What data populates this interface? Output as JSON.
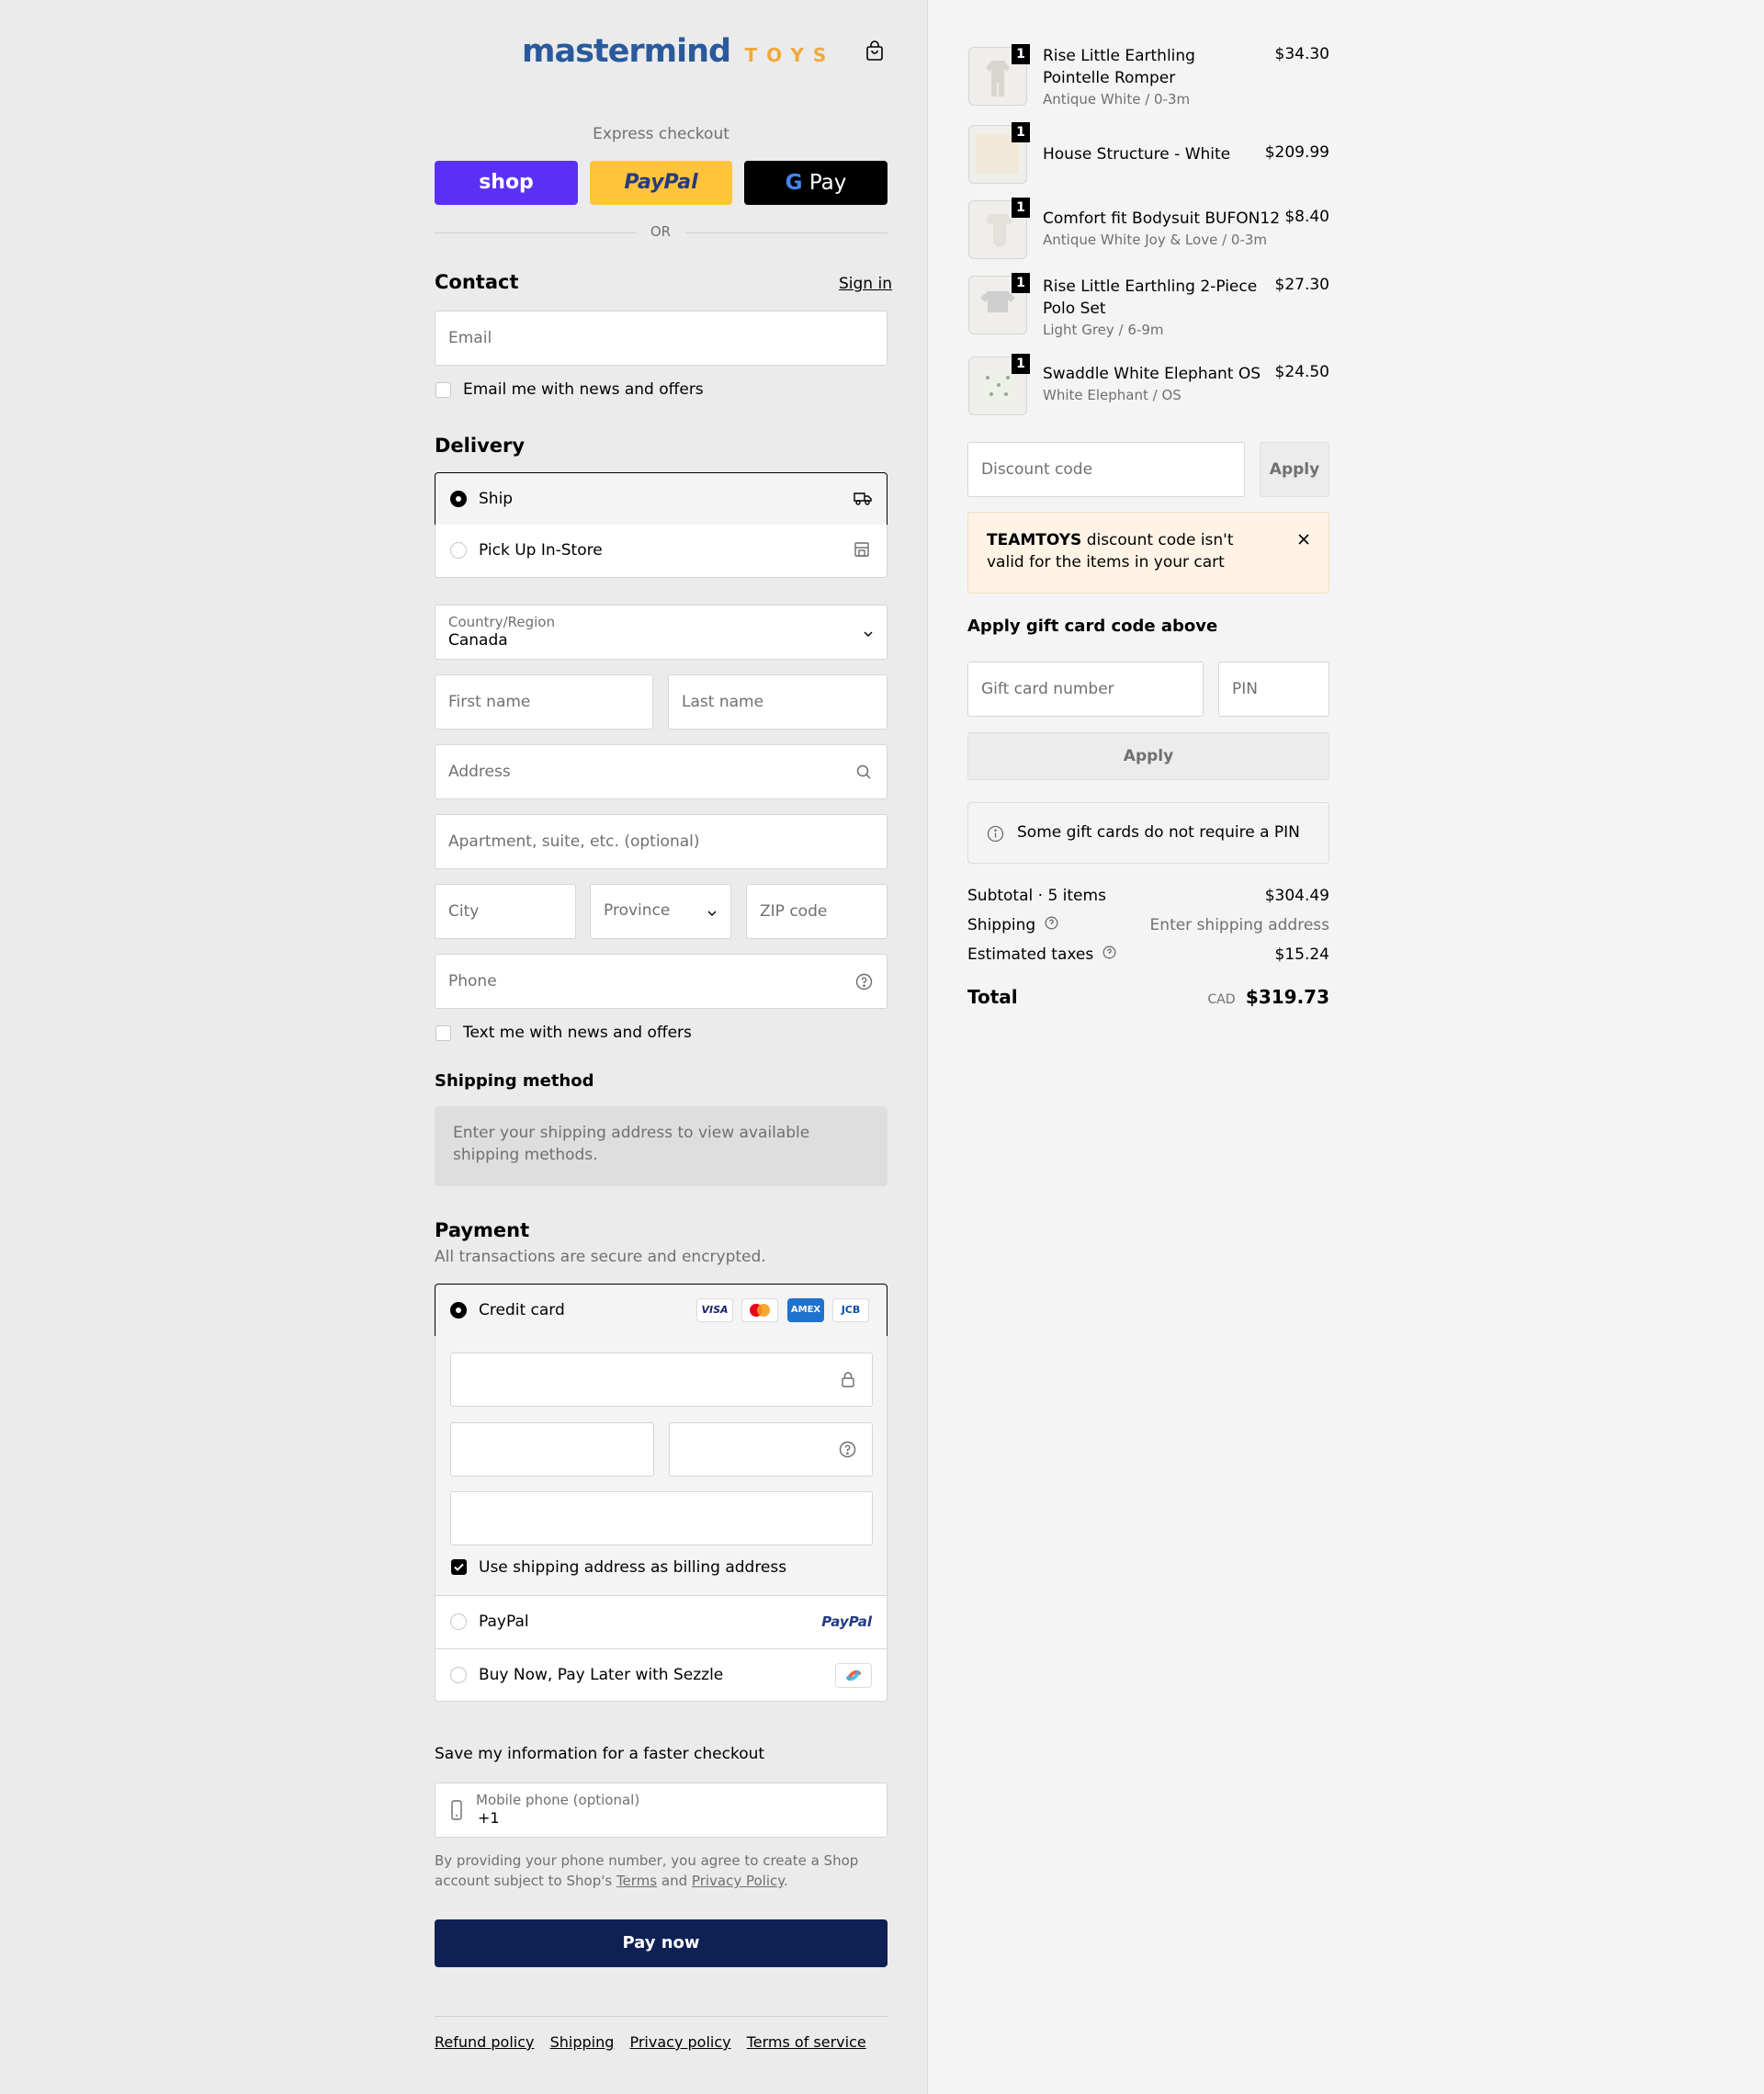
{
  "brand": {
    "name_main": "mastermind",
    "name_sub": "TOYS",
    "main_color": "#2a5a9c",
    "sub_color": "#f2a93b"
  },
  "cart_icon": "shopping-bag-icon",
  "express": {
    "title": "Express checkout",
    "shop_label": "shop",
    "paypal_label": "PayPal",
    "gpay_label": "Pay",
    "or_label": "OR",
    "colors": {
      "shop": "#5a31f4",
      "paypal": "#ffc439",
      "gpay": "#000000"
    }
  },
  "contact": {
    "title": "Contact",
    "sign_in": "Sign in",
    "email_placeholder": "Email",
    "newsletter_label": "Email me with news and offers"
  },
  "delivery": {
    "title": "Delivery",
    "options": [
      {
        "label": "Ship",
        "selected": true,
        "icon": "truck-icon"
      },
      {
        "label": "Pick Up In-Store",
        "selected": false,
        "icon": "store-icon"
      }
    ],
    "country_label": "Country/Region",
    "country_value": "Canada",
    "first_name": "First name",
    "last_name": "Last name",
    "address": "Address",
    "apartment": "Apartment, suite, etc. (optional)",
    "city": "City",
    "province": "Province",
    "zip": "ZIP code",
    "phone": "Phone",
    "sms_label": "Text me with news and offers"
  },
  "shipping_method": {
    "title": "Shipping method",
    "notice": "Enter your shipping address to view available shipping methods."
  },
  "payment": {
    "title": "Payment",
    "subtitle": "All transactions are secure and encrypted.",
    "credit_card": "Credit card",
    "card_brands": [
      "VISA",
      "MC",
      "AMEX",
      "JCB"
    ],
    "billing_label": "Use shipping address as billing address",
    "paypal": "PayPal",
    "paypal_logo": "PayPal",
    "sezzle": "Buy Now, Pay Later with Sezzle"
  },
  "save_info": {
    "title": "Save my information for a faster checkout",
    "mobile_label": "Mobile phone (optional)",
    "mobile_value": "+1",
    "disclaimer_a": "By providing your phone number, you agree to create a Shop account subject to Shop's",
    "terms": "Terms",
    "and": "and",
    "privacy": "Privacy Policy",
    "period": "."
  },
  "pay_now": "Pay now",
  "pay_now_color": "#0f2054",
  "footer_links": [
    "Refund policy",
    "Shipping",
    "Privacy policy",
    "Terms of service"
  ],
  "cart": {
    "items": [
      {
        "name": "Rise Little Earthling Pointelle Romper",
        "variant": "Antique White / 0-3m",
        "price": "$34.30",
        "qty": "1"
      },
      {
        "name": "House Structure - White",
        "variant": "",
        "price": "$209.99",
        "qty": "1"
      },
      {
        "name": "Comfort fit Bodysuit BUFON12",
        "variant": "Antique White Joy & Love / 0-3m",
        "price": "$8.40",
        "qty": "1"
      },
      {
        "name": "Rise Little Earthling 2-Piece Polo Set",
        "variant": "Light Grey / 6-9m",
        "price": "$27.30",
        "qty": "1"
      },
      {
        "name": "Swaddle White Elephant OS",
        "variant": "White Elephant / OS",
        "price": "$24.50",
        "qty": "1"
      }
    ]
  },
  "discount": {
    "placeholder": "Discount code",
    "apply": "Apply",
    "error_code": "TEAMTOYS",
    "error_text": "discount code isn't valid for the items in your cart"
  },
  "gift": {
    "title": "Apply gift card code above",
    "number": "Gift card number",
    "pin": "PIN",
    "apply": "Apply",
    "info": "Some gift cards do not require a PIN"
  },
  "summary": {
    "subtotal_label": "Subtotal · 5 items",
    "subtotal_value": "$304.49",
    "shipping_label": "Shipping",
    "shipping_value": "Enter shipping address",
    "taxes_label": "Estimated taxes",
    "taxes_value": "$15.24",
    "total_label": "Total",
    "currency": "CAD",
    "total_value": "$319.73"
  }
}
